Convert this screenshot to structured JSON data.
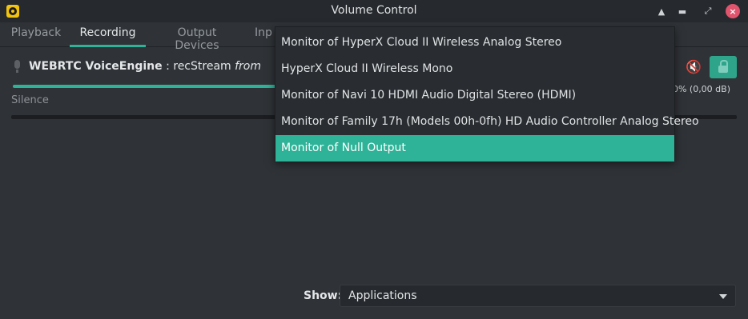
{
  "window": {
    "title": "Volume Control"
  },
  "tabs": [
    {
      "label": "Playback",
      "active": false
    },
    {
      "label": "Recording",
      "active": true
    },
    {
      "label": "Output Devices",
      "active": false
    },
    {
      "label": "Inp",
      "active": false
    }
  ],
  "stream": {
    "app_name": "WEBRTC VoiceEngine",
    "separator": " : ",
    "stream_name": "recStream",
    "from_text": "from",
    "volume_readout": "100% (0,00 dB)",
    "silence_label": "Silence",
    "muted": false,
    "locked": true
  },
  "source_dropdown": {
    "items": [
      "Monitor of HyperX Cloud II Wireless Analog Stereo",
      "HyperX Cloud II Wireless Mono",
      "Monitor of Navi 10 HDMI Audio Digital Stereo (HDMI)",
      "Monitor of Family 17h (Models 00h-0fh) HD Audio Controller Analog Stereo",
      "Monitor of Null Output"
    ],
    "selected_index": 4
  },
  "footer": {
    "show_label": "Show:",
    "show_value": "Applications"
  },
  "colors": {
    "accent": "#2eb398",
    "background": "#2f3337",
    "close_button": "#e0546d"
  },
  "icons": {
    "app": "pavucontrol-icon",
    "stream": "microphone-icon",
    "mute": "speaker-mute-icon",
    "lock": "lock-icon"
  }
}
